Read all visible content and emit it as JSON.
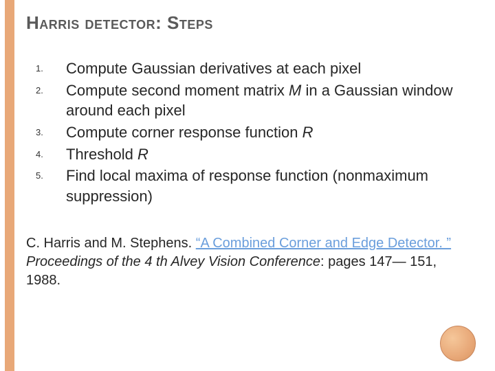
{
  "title": "Harris detector: Steps",
  "steps": [
    {
      "text": "Compute Gaussian derivatives at each pixel"
    },
    {
      "pre": "Compute second moment matrix ",
      "var": "M",
      "post": " in a Gaussian window around each pixel"
    },
    {
      "pre": "Compute corner response function ",
      "var": "R",
      "post": ""
    },
    {
      "pre": "Threshold ",
      "var": "R",
      "post": ""
    },
    {
      "text": "Find local maxima of response function (nonmaximum suppression)"
    }
  ],
  "citation": {
    "authors": "C. Harris and M. Stephens. ",
    "link": "“A Combined Corner and Edge Detector. ”",
    "conf": "Proceedings of the 4 th Alvey Vision Conference",
    "tail": ": pages 147— 151, 1988."
  }
}
